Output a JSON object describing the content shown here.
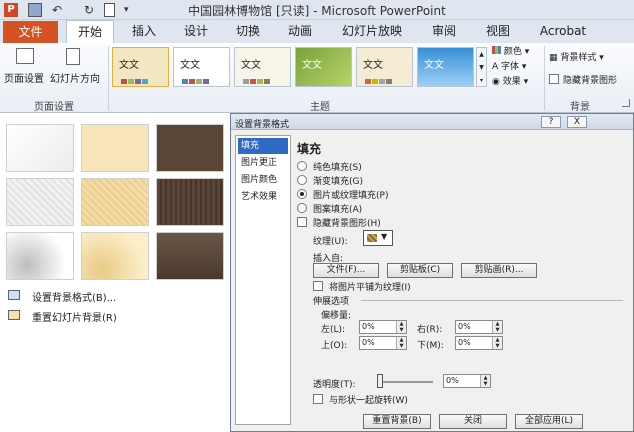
{
  "window": {
    "title": "中国园林博物馆 [只读] - Microsoft PowerPoint"
  },
  "tabs": [
    "文件",
    "开始",
    "插入",
    "设计",
    "切换",
    "动画",
    "幻灯片放映",
    "审阅",
    "视图",
    "Acrobat"
  ],
  "ribbon": {
    "page_setup": "页面设置",
    "orientation": "幻灯片方向",
    "group_page": "页面设置",
    "group_theme": "主题",
    "group_bg": "背景",
    "theme_text": "文文",
    "colors": "颜色",
    "fonts": "字体",
    "effects": "效果",
    "bg_styles": "背景样式",
    "hide_bg": "隐藏背景图形"
  },
  "bgpanel": {
    "format_bg": "设置背景格式(B)...",
    "reset_bg": "重置幻灯片背景(R)"
  },
  "dialog": {
    "title": "设置背景格式",
    "nav": [
      "填充",
      "图片更正",
      "图片颜色",
      "艺术效果"
    ],
    "heading": "填充",
    "solid": "纯色填充(S)",
    "gradient": "渐变填充(G)",
    "picture": "图片或纹理填充(P)",
    "pattern": "图案填充(A)",
    "hide_graphics": "隐藏背景图形(H)",
    "texture": "纹理(U):",
    "insert_from": "插入自:",
    "file_btn": "文件(F)...",
    "clipboard_btn": "剪贴板(C)",
    "clipart_btn": "剪贴画(R)...",
    "tile": "将图片平铺为纹理(I)",
    "stretch": "伸展选项",
    "offset": "偏移量:",
    "left": "左(L):",
    "right": "右(R):",
    "top": "上(O):",
    "bottom": "下(M):",
    "val_left": "0%",
    "val_right": "0%",
    "val_top": "0%",
    "val_bottom": "0%",
    "transparency": "透明度(T):",
    "val_transparency": "0%",
    "rotate": "与形状一起旋转(W)",
    "reset_btn": "重置背景(B)",
    "close_btn": "关闭",
    "apply_all_btn": "全部应用(L)",
    "help_btn": "?",
    "close_x": "X"
  }
}
